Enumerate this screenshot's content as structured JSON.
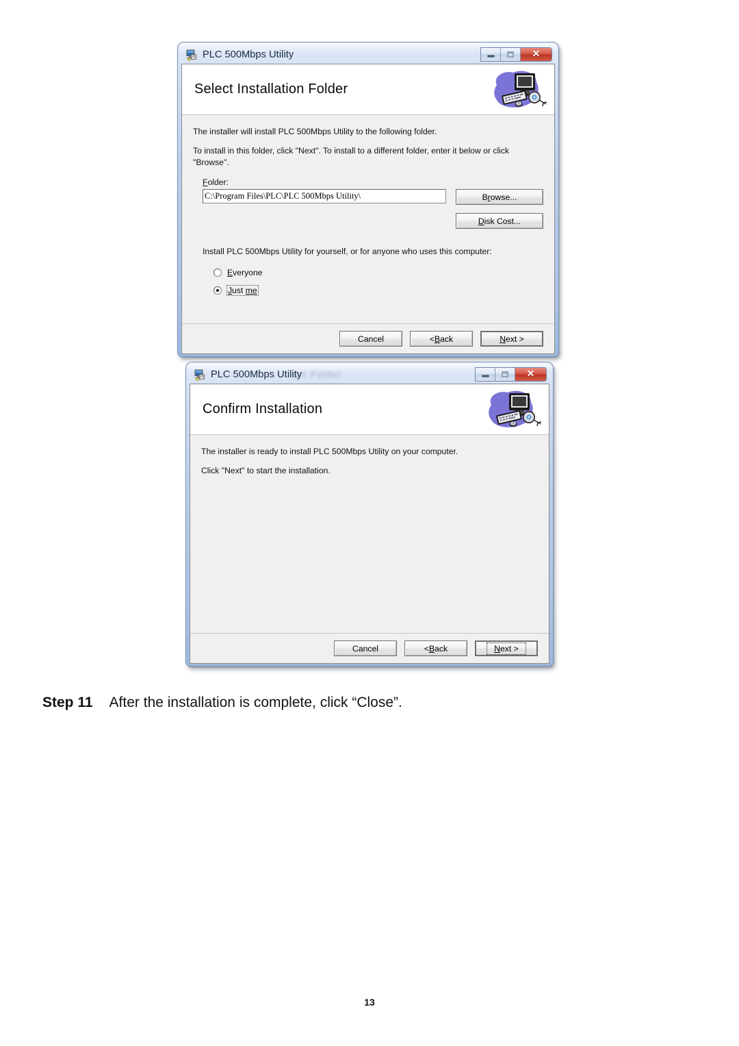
{
  "page": {
    "number": "13",
    "step": {
      "label": "Step 11",
      "text": "After the installation is complete, click “Close”."
    }
  },
  "dialog_select_folder": {
    "title": "PLC 500Mbps Utility",
    "title_icon": "msi-installer-icon",
    "banner_icon": "computer-setup-banner-icon",
    "window_buttons": {
      "minimize": "minimize-icon",
      "maximize": "maximize-icon",
      "close": "close-icon",
      "close_glyph": "✕"
    },
    "header_title": "Select Installation Folder",
    "paragraph_1": "The installer will install PLC 500Mbps Utility to the following folder.",
    "paragraph_2": "To install in this folder, click \"Next\". To install to a different folder, enter it below or click \"Browse\".",
    "folder_label": "Folder:",
    "folder_value": "C:\\Program Files\\PLC\\PLC 500Mbps Utility\\",
    "browse_button": "Browse...",
    "disk_cost_button": "Disk Cost...",
    "install_for_text": "Install PLC 500Mbps Utility for yourself, or for anyone who uses this computer:",
    "radio_options": [
      {
        "label": "Everyone",
        "checked": false,
        "focused": false
      },
      {
        "label": "Just me",
        "checked": true,
        "focused": true
      }
    ],
    "footer_buttons": {
      "cancel": "Cancel",
      "back": "< Back",
      "next": "Next >"
    }
  },
  "dialog_confirm_install": {
    "title": "PLC 500Mbps Utility",
    "title_ghost_artifact": "ion Folder",
    "title_icon": "msi-installer-icon",
    "banner_icon": "computer-setup-banner-icon",
    "window_buttons": {
      "minimize": "minimize-icon",
      "maximize": "maximize-icon",
      "close": "close-icon",
      "close_glyph": "✕"
    },
    "header_title": "Confirm Installation",
    "paragraph_1": "The installer is ready to install PLC 500Mbps Utility on your computer.",
    "paragraph_2": "Click \"Next\" to start the installation.",
    "footer_buttons": {
      "cancel": "Cancel",
      "back": "< Back",
      "next": "Next >"
    }
  },
  "colors": {
    "title_bar_blue": "#bcd0ec",
    "close_red": "#bc3322",
    "client_gray": "#f0f0f0",
    "header_white": "#ffffff",
    "banner_purple": "#6f6fc8"
  }
}
